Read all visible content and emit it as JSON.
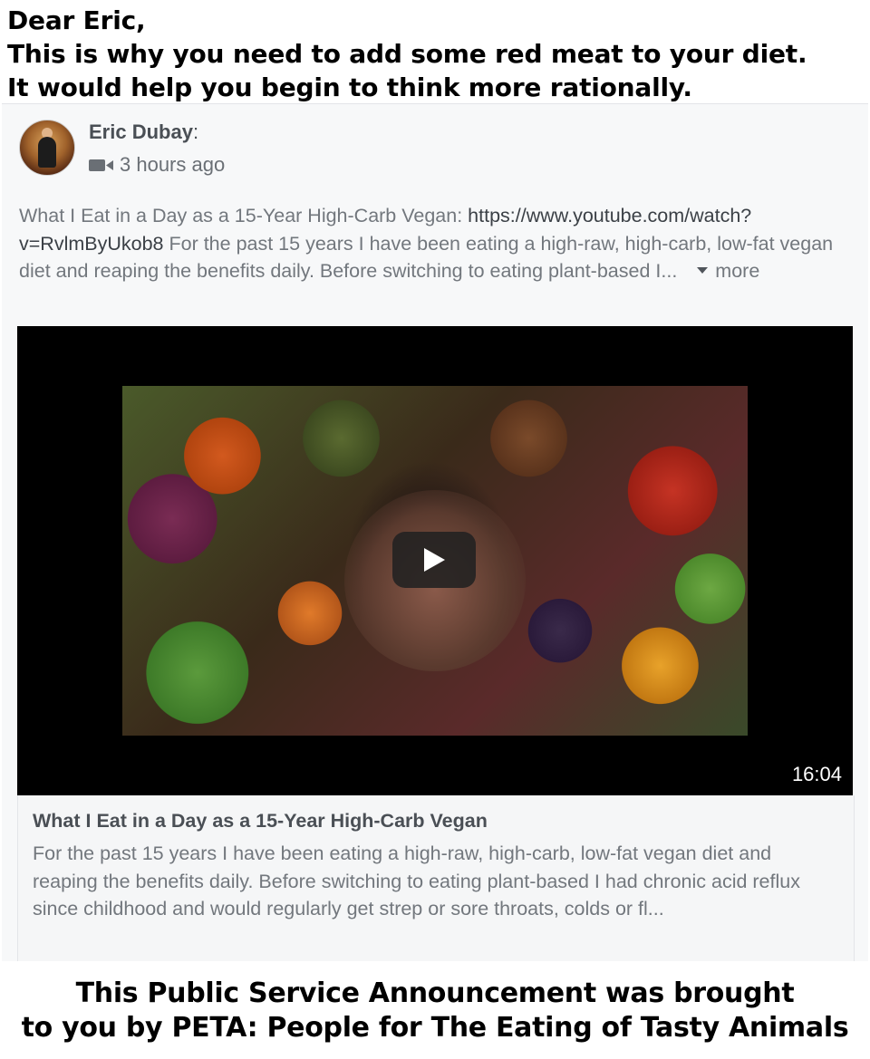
{
  "top_caption": {
    "lines": [
      "Dear Eric,",
      "This is why you need to add some red meat to your diet.",
      "It would help you begin to think more rationally."
    ]
  },
  "post": {
    "author": "Eric Dubay",
    "colon": ":",
    "video_icon": "video-camera-icon",
    "timestamp": "3 hours ago",
    "text_prefix": "What I Eat in a Day as a 15-Year High-Carb Vegan: ",
    "link": "https://www.youtube.com/watch?v=RvlmByUkob8",
    "text_body": " For the past 15 years I have been eating a high-raw, high-carb, low-fat vegan diet and reaping the benefits daily. Before switching to eating plant-based I...",
    "more_label": "more"
  },
  "video": {
    "play_icon": "play-icon",
    "duration": "16:04"
  },
  "preview": {
    "title": "What I Eat in a Day as a 15-Year High-Carb Vegan",
    "description": "For the past 15 years I have been eating a high-raw, high-carb, low-fat vegan diet and reaping the benefits daily. Before switching to eating plant-based I had chronic acid reflux since childhood and would regularly get strep or sore throats, colds or fl..."
  },
  "bottom_caption": {
    "lines": [
      "This Public Service Announcement was brought",
      "to you by PETA: People for The Eating of Tasty Animals"
    ]
  }
}
